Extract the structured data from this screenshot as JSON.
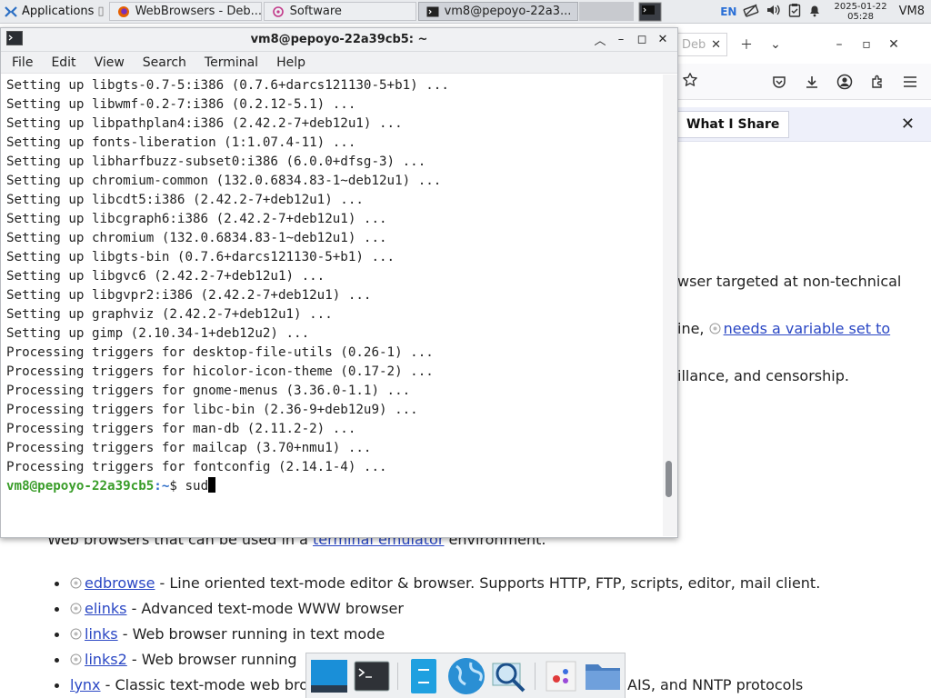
{
  "panel": {
    "apps_label": "Applications",
    "tasks": [
      {
        "label": "WebBrowsers - Deb...",
        "icon": "firefox-icon"
      },
      {
        "label": "Software",
        "icon": "software-icon"
      },
      {
        "label": "vm8@pepoyo-22a3...",
        "icon": "terminal-icon"
      }
    ],
    "keyboard_layout": "EN",
    "date": "2025-01-22",
    "time": "05:28",
    "user": "VM8"
  },
  "browser": {
    "tab_label": "Deb",
    "notification_label": "What I Share",
    "text_line1": "wser targeted at non-technical",
    "text_line2_prefix": "ine, ",
    "text_line2_link": "needs a variable set to",
    "text_line3": "illance, and censorship.",
    "text_terminal_prefix": "Web browsers that can be used in a ",
    "text_terminal_link": "terminal emulator",
    "text_terminal_suffix": " environment.",
    "items": [
      {
        "link": "edbrowse",
        "desc": " - Line oriented text-mode editor & browser. Supports HTTP, FTP, scripts, editor, mail client."
      },
      {
        "link": "elinks",
        "desc": " - Advanced text-mode WWW browser"
      },
      {
        "link": "links",
        "desc": " - Web browser running in text mode"
      },
      {
        "link": "links2",
        "desc": " - Web browser running"
      },
      {
        "link": "lynx",
        "desc": " - Classic text-mode web bro",
        "tail": "AIS, and NNTP protocols"
      }
    ]
  },
  "terminal": {
    "title": "vm8@pepoyo-22a39cb5: ~",
    "menu": [
      "File",
      "Edit",
      "View",
      "Search",
      "Terminal",
      "Help"
    ],
    "lines": [
      "Setting up libgts-0.7-5:i386 (0.7.6+darcs121130-5+b1) ...",
      "Setting up libwmf-0.2-7:i386 (0.2.12-5.1) ...",
      "Setting up libpathplan4:i386 (2.42.2-7+deb12u1) ...",
      "Setting up fonts-liberation (1:1.07.4-11) ...",
      "Setting up libharfbuzz-subset0:i386 (6.0.0+dfsg-3) ...",
      "Setting up chromium-common (132.0.6834.83-1~deb12u1) ...",
      "Setting up libcdt5:i386 (2.42.2-7+deb12u1) ...",
      "Setting up libcgraph6:i386 (2.42.2-7+deb12u1) ...",
      "Setting up chromium (132.0.6834.83-1~deb12u1) ...",
      "Setting up libgts-bin (0.7.6+darcs121130-5+b1) ...",
      "Setting up libgvc6 (2.42.2-7+deb12u1) ...",
      "Setting up libgvpr2:i386 (2.42.2-7+deb12u1) ...",
      "Setting up graphviz (2.42.2-7+deb12u1) ...",
      "Setting up gimp (2.10.34-1+deb12u2) ...",
      "Processing triggers for desktop-file-utils (0.26-1) ...",
      "Processing triggers for hicolor-icon-theme (0.17-2) ...",
      "Processing triggers for gnome-menus (3.36.0-1.1) ...",
      "Processing triggers for libc-bin (2.36-9+deb12u9) ...",
      "Processing triggers for man-db (2.11.2-2) ...",
      "Processing triggers for mailcap (3.70+nmu1) ...",
      "Processing triggers for fontconfig (2.14.1-4) ..."
    ],
    "prompt_user": "vm8@pepoyo-22a39cb5",
    "prompt_path": ":~",
    "prompt_symbol": "$ ",
    "input": "sud",
    "scroll_position": 0.92
  },
  "dock": {
    "items": [
      "show-desktop-icon",
      "terminal-icon",
      "file-manager-icon",
      "web-browser-icon",
      "app-finder-icon",
      "image-viewer-icon",
      "folder-icon"
    ]
  }
}
